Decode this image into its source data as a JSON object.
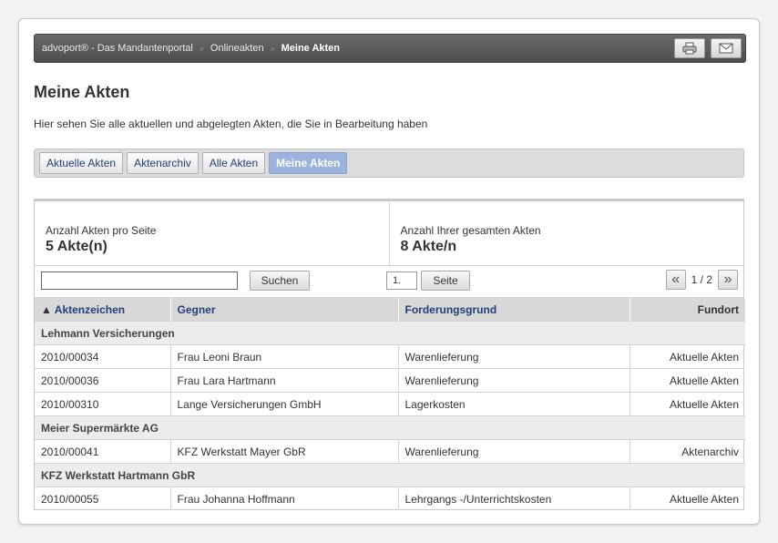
{
  "breadcrumb": {
    "items": [
      "advoport® - Das Mandantenportal",
      "Onlineakten",
      "Meine Akten"
    ],
    "separator": "»"
  },
  "toolbar": {
    "print_icon": "printer-icon",
    "mail_icon": "envelope-icon"
  },
  "page": {
    "title": "Meine Akten",
    "intro": "Hier sehen Sie alle aktuellen und abgelegten Akten, die Sie in Bearbeitung haben"
  },
  "tabs": [
    {
      "label": "Aktuelle Akten",
      "active": false
    },
    {
      "label": "Aktenarchiv",
      "active": false
    },
    {
      "label": "Alle Akten",
      "active": false
    },
    {
      "label": "Meine Akten",
      "active": true
    }
  ],
  "stats": {
    "per_page_label": "Anzahl Akten pro Seite",
    "per_page_value": "5 Akte(n)",
    "total_label": "Anzahl Ihrer gesamten Akten",
    "total_value": "8 Akte/n"
  },
  "controls": {
    "search_value": "",
    "search_button": "Suchen",
    "page_value": "1.",
    "page_button": "Seite",
    "prev": "«",
    "next": "»",
    "page_info": "1 / 2"
  },
  "table": {
    "sort_indicator": "▲",
    "columns": [
      "Aktenzeichen",
      "Gegner",
      "Forderungsgrund",
      "Fundort"
    ],
    "groups": [
      {
        "name": "Lehmann Versicherungen",
        "rows": [
          [
            "2010/00034",
            "Frau Leoni Braun",
            "Warenlieferung",
            "Aktuelle Akten"
          ],
          [
            "2010/00036",
            "Frau Lara Hartmann",
            "Warenlieferung",
            "Aktuelle Akten"
          ],
          [
            "2010/00310",
            "Lange Versicherungen GmbH",
            "Lagerkosten",
            "Aktuelle Akten"
          ]
        ]
      },
      {
        "name": "Meier Supermärkte AG",
        "rows": [
          [
            "2010/00041",
            "KFZ Werkstatt Mayer GbR",
            "Warenlieferung",
            "Aktenarchiv"
          ]
        ]
      },
      {
        "name": "KFZ Werkstatt Hartmann GbR",
        "rows": [
          [
            "2010/00055",
            "Frau Johanna Hoffmann",
            "Lehrgangs -/Unterrichtskosten",
            "Aktuelle Akten"
          ]
        ]
      }
    ]
  },
  "colors": {
    "accent": "#233f7a",
    "active_tab": "#9cb3dd",
    "header_bar": "#5a5a5a"
  }
}
